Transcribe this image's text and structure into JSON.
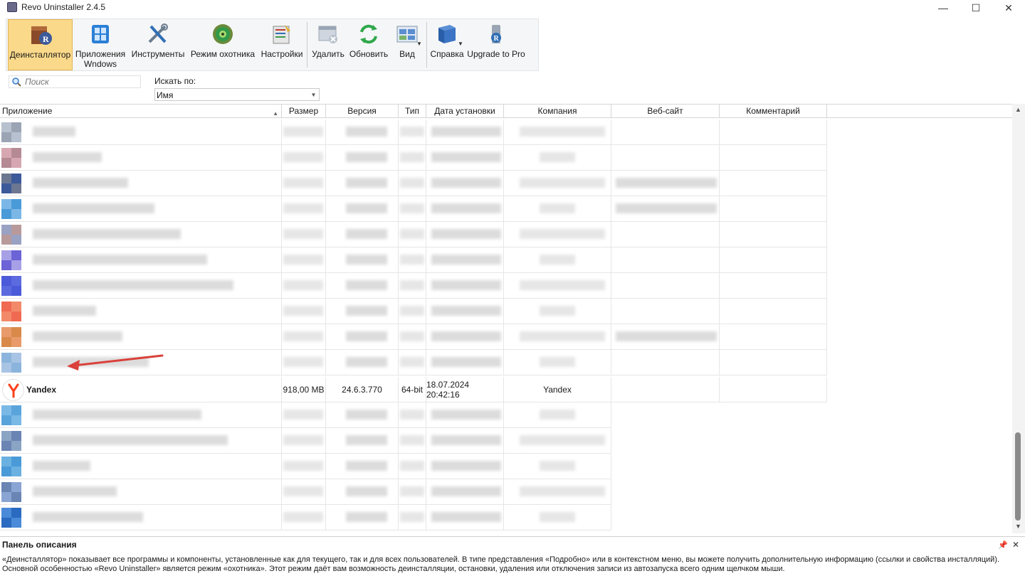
{
  "window": {
    "title": "Revo Uninstaller 2.4.5",
    "controls": {
      "minimize": "—",
      "maximize": "☐",
      "close": "✕"
    }
  },
  "toolbar": {
    "buttons": [
      {
        "label": "Деинсталлятор",
        "icon": "uninstaller-icon"
      },
      {
        "label": "Приложения\nWndows",
        "icon": "windows-apps-icon"
      },
      {
        "label": "Инструменты",
        "icon": "tools-icon"
      },
      {
        "label": "Режим охотника",
        "icon": "hunter-mode-icon"
      },
      {
        "label": "Настройки",
        "icon": "settings-icon"
      },
      {
        "label": "Удалить",
        "icon": "remove-icon"
      },
      {
        "label": "Обновить",
        "icon": "refresh-icon"
      },
      {
        "label": "Вид",
        "icon": "view-icon"
      },
      {
        "label": "Справка",
        "icon": "help-book-icon"
      },
      {
        "label": "Upgrade to Pro",
        "icon": "upgrade-icon"
      }
    ]
  },
  "search": {
    "placeholder": "Поиск",
    "search_by_label": "Искать по:",
    "search_by_value": "Имя"
  },
  "table": {
    "columns": [
      "Приложение",
      "Размер",
      "Версия",
      "Тип",
      "Дата установки",
      "Компания",
      "Веб-сайт",
      "Комментарий"
    ],
    "highlighted_row": {
      "app": "Yandex",
      "size": "918,00 MB",
      "version": "24.6.3.770",
      "type": "64-bit",
      "install_date": "18.07.2024 20:42:16",
      "company": "Yandex",
      "website": "",
      "comment": ""
    }
  },
  "description_panel": {
    "title": "Панель описания",
    "line1": "«Деинсталлятор» показывает все программы и компоненты, установленные как для текущего, так и для всех пользователей. В типе представления «Подробно» или в контекстном меню, вы можете получить дополнительную информацию (ссылки и свойства инсталляций).",
    "line2": "Основной особенностью «Revo Uninstaller» является режим «охотника». Этот режим даёт вам возможность деинсталляции, остановки, удаления или отключения записи из автозапуска всего одним щелчком мыши."
  },
  "colors": {
    "active_tool": "#fbd98a",
    "annotation_arrow": "#d9413a",
    "yandex_red": "#fc3f1d"
  }
}
